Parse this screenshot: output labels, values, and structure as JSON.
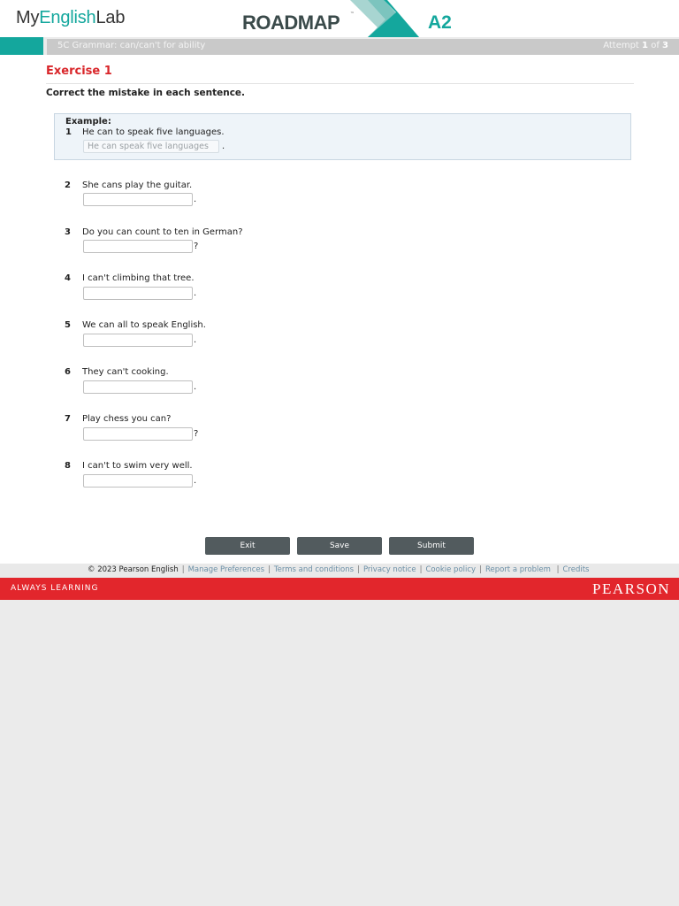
{
  "header": {
    "brand_my": "My",
    "brand_english": "English",
    "brand_lab": "Lab",
    "product": "ROADMAP",
    "trademark": "™",
    "level": "A2"
  },
  "subbar": {
    "title": "5C Grammar: can/can't for ability",
    "attempt_prefix": "Attempt",
    "attempt_current": "1",
    "attempt_of": "of",
    "attempt_total": "3"
  },
  "exercise": {
    "title": "Exercise 1",
    "instruction": "Correct the mistake in each sentence.",
    "example_label": "Example:",
    "example": {
      "number": "1",
      "text": "He can to speak five languages.",
      "answer": "He can speak five languages",
      "punct": "."
    },
    "questions": [
      {
        "number": "2",
        "text": "She cans play the guitar.",
        "value": "",
        "punct": "."
      },
      {
        "number": "3",
        "text": "Do you can count to ten in German?",
        "value": "",
        "punct": "?"
      },
      {
        "number": "4",
        "text": "I can't climbing that tree.",
        "value": "",
        "punct": "."
      },
      {
        "number": "5",
        "text": "We can all to speak English.",
        "value": "",
        "punct": "."
      },
      {
        "number": "6",
        "text": "They can't cooking.",
        "value": "",
        "punct": "."
      },
      {
        "number": "7",
        "text": "Play chess you can?",
        "value": "",
        "punct": "?"
      },
      {
        "number": "8",
        "text": "I can't to swim very well.",
        "value": "",
        "punct": "."
      }
    ]
  },
  "buttons": {
    "exit": "Exit",
    "save": "Save",
    "submit": "Submit"
  },
  "footer": {
    "copyright": "© 2023 Pearson English",
    "links": [
      "Manage Preferences",
      "Terms and conditions",
      "Privacy notice",
      "Cookie policy",
      "Report a problem",
      "Credits"
    ],
    "tagline": "ALWAYS LEARNING",
    "brand": "PEARSON"
  },
  "colors": {
    "teal": "#14a79d",
    "red": "#e2262c",
    "exercise_title": "#d9262a",
    "button": "#525b5e"
  }
}
